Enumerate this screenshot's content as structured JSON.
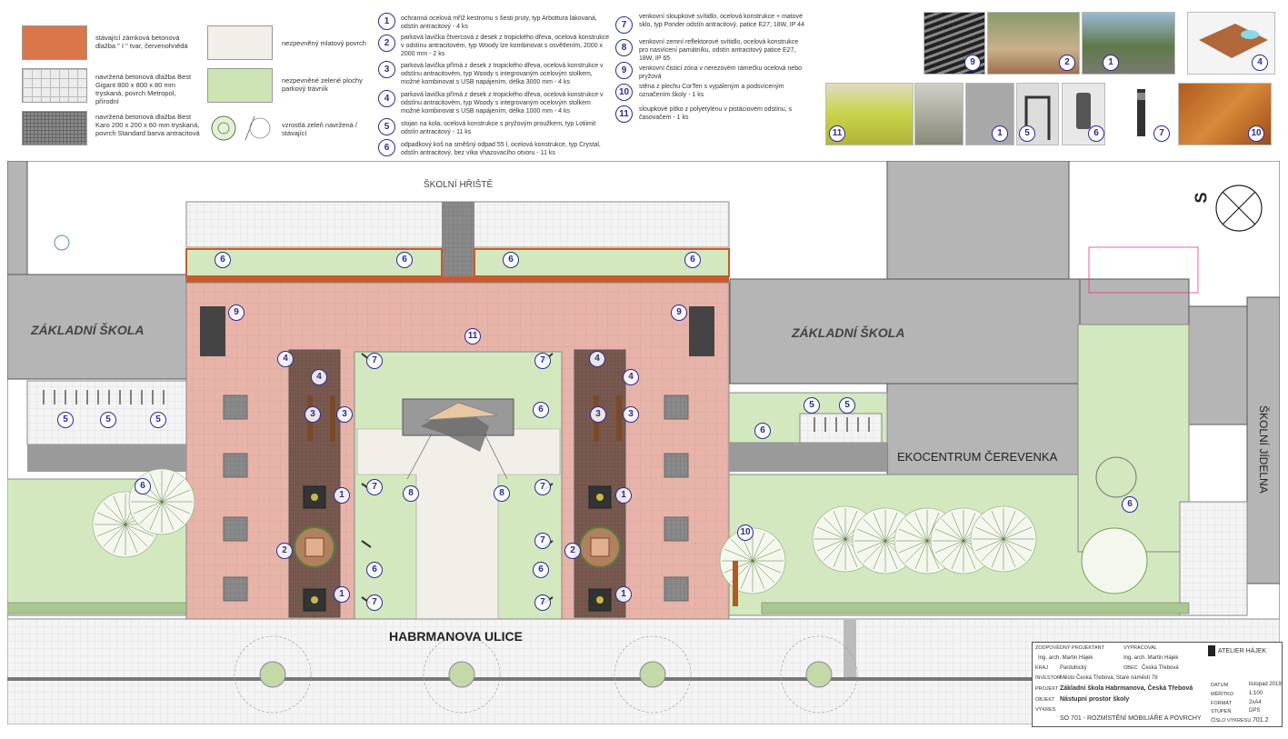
{
  "legend": [
    {
      "label": "stávající zámková betonová dlažba \" I \" tvar, červenohnědá",
      "color": "#d9764a"
    },
    {
      "label": "navržená betonová dlažba Best Gigant 800 x 800 x 80 mm tryskaná, povrch Metropol, přírodní",
      "color": "#ececec"
    },
    {
      "label": "navržená betonová dlažba Best Karo 200 x 200 x 60 mm tryskaná, povrch Standard barva antracitová",
      "color": "#8a8a8a"
    },
    {
      "label": "nezpevněný mlatový povrch",
      "color": "#f2efe8"
    },
    {
      "label": "nezpevněné zelené plochy parkový trávník",
      "color": "#cde4b4"
    },
    {
      "label": "vzrostlá zeleň navržená / stávající",
      "color": "#ffffff"
    }
  ],
  "items": [
    {
      "num": "1",
      "text": "ochranná ocelová mříž kestromu s šesti pruty, typ Arbottura lakovaná, odstín antracitový - 4 ks"
    },
    {
      "num": "2",
      "text": "parková lavička čtvercová z desek z tropického dřeva, ocelová konstrukce v odstínu antracitovém, typ Woody lze kombinovat s osvětlením, 2000 x 2000 mm - 2 ks"
    },
    {
      "num": "3",
      "text": "parková lavička přímá z desek z tropického dřeva, ocelová konstrukce v odstínu antracitovém, typ Woody s integrovaným ocelovým stolkem, možné kombinovat s USB napájením, délka 3000 mm - 4 ks"
    },
    {
      "num": "4",
      "text": "parková lavička přímá z desek z tropického dřeva, ocelová konstrukce v odstínu antracitovém, typ Woody s integrovaným ocelovým stolkem možné kombinovat s USB napájením, délka 1000 mm - 4 ks"
    },
    {
      "num": "5",
      "text": "stojan na kola, ocelová konstrukce s pryžovým proužkem, typ Lotiimit odstín antracitový - 11 ks"
    },
    {
      "num": "6",
      "text": "odpadkový koš na směšný odpad 55 l, ocelová konstrukce, typ Crystal, odstín antracitový, bez víka vhazovacího otvoru - 11 ks"
    },
    {
      "num": "7",
      "text": "venkovní sloupkové svítidlo, ocelová konstrukce + matové sklo, typ Ponder odstín antracitový, patice E27, 18W, IP 44"
    },
    {
      "num": "8",
      "text": "venkovní zemní reflektorové svítidlo, ocelová konstrukce pro nasvícení památníku, odstín antracitový patice E27, 18W, IP 65"
    },
    {
      "num": "9",
      "text": "venkovní čisticí zóna v nerezovém rámečku ocelová nebo pryžová"
    },
    {
      "num": "10",
      "text": "stěna z plechu CorTen s vypáleným a podsvíceným označením školy - 1 ks"
    },
    {
      "num": "11",
      "text": "sloupkové pítko z polyetylénu v pistáciovém odstínu, s časovačem - 1 ks"
    }
  ],
  "photos": [
    "9",
    "2",
    "1",
    "4",
    "11",
    "1",
    "5",
    "6",
    "7",
    "10"
  ],
  "plan": {
    "labels": {
      "playground": "ŠKOLNÍ HŘIŠTĚ",
      "school_left": "ZÁKLADNÍ ŠKOLA",
      "school_right": "ZÁKLADNÍ ŠKOLA",
      "eco": "EKOCENTRUM ČEREVENKA",
      "canteen": "ŠKOLNÍ JÍDELNA",
      "street": "HABRMANOVA ULICE",
      "north": "S"
    },
    "colors": {
      "paving": "#e8b4a9",
      "lawn": "#d3e8bf",
      "building": "#b5b5b5",
      "brick": "#c95a30",
      "dark": "#7a5a50"
    }
  },
  "titleblock": {
    "r1a": "ZODPOVĚDNÝ PROJEKTANT",
    "r1b": "VYPRACOVAL",
    "name1": "Ing. arch. Martin Hájek",
    "name2": "Ing. arch. Martin Hájek",
    "kraj_l": "KRAJ",
    "kraj": "Pardubický",
    "obec_l": "OBEC",
    "obec": "Česká Třebová",
    "inv_l": "INVESTOR",
    "inv": "Město Česká Třebová, Staré náměstí 78",
    "proj_l": "PROJEKT",
    "proj": "Základní škola Habrmanova, Česká Třebová",
    "obj_l": "OBJEKT",
    "obj": "Nástupní prostor školy",
    "vyk_l": "VÝKRES",
    "vyk": "SO 701 - ROZMÍSTĚNÍ MOBILIÁŘE A POVRCHY",
    "firm": "ATELIER HÁJEK",
    "date_l": "DATUM",
    "date": "listopad 2019",
    "scale_l": "MĚŘÍTKO",
    "scale": "1:100",
    "fmt_l": "FORMÁT",
    "fmt": "2xA4",
    "stage_l": "STUPEŇ",
    "stage": "DPS",
    "no_l": "ČÍSLO VÝKRESU",
    "no": "701.2"
  }
}
